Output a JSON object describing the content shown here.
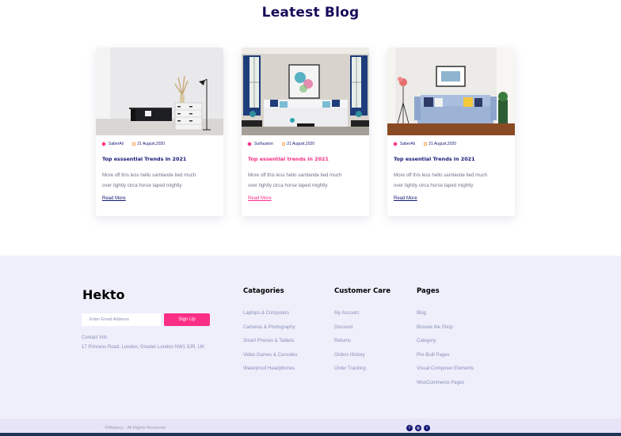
{
  "section": {
    "title": "Leatest Blog"
  },
  "posts": [
    {
      "author": "SaberAli",
      "date": "21 August,2020",
      "title": "Top esssential Trends in 2021",
      "excerpt_line1": "More off this less hello samlande lied much",
      "excerpt_line2": "over tightly circa horse taped mightly",
      "read_more": "Read More"
    },
    {
      "author": "Surfauxion",
      "date": "21 August,2020",
      "title": "Top essential trends in 2021",
      "excerpt_line1": "More off this less hello samlande lied much",
      "excerpt_line2": "over tightly circa horse taped mightly",
      "read_more": "Read More"
    },
    {
      "author": "SaberAli",
      "date": "21 August,2020",
      "title": "Top essential Trends in 2021",
      "excerpt_line1": "More off this less hello samlande lied much",
      "excerpt_line2": "over tightly circa horse taped mightly",
      "read_more": "Read More"
    }
  ],
  "footer": {
    "brand": "Hekto",
    "email_placeholder": "Enter Email Address",
    "signup_label": "Sign Up",
    "contact_label": "Contact Info",
    "contact_address": "17 Princess Road, London, Greater London NW1 8JR, UK",
    "categories": {
      "title": "Catagories",
      "items": [
        "Laptops & Computers",
        "Cameras & Photography",
        "Smart Phones & Tablets",
        "Video Games & Consoles",
        "Waterproof Headphones"
      ]
    },
    "customer_care": {
      "title": "Customer Care",
      "items": [
        "My Account",
        "Discount",
        "Returns",
        "Orders History",
        "Order Tracking"
      ]
    },
    "pages": {
      "title": "Pages",
      "items": [
        "Blog",
        "Browse the Shop",
        "Category",
        "Pre-Built Pages",
        "Visual Composer Elements",
        "WooCommerce Pages"
      ]
    }
  },
  "bottom": {
    "copyright": "©Webecy - All Rights Reserved",
    "social": [
      "facebook-icon",
      "instagram-icon",
      "twitter-icon"
    ]
  },
  "colors": {
    "accent_pink": "#fb2e86",
    "navy": "#151875",
    "footer_bg": "#eeeffb"
  }
}
